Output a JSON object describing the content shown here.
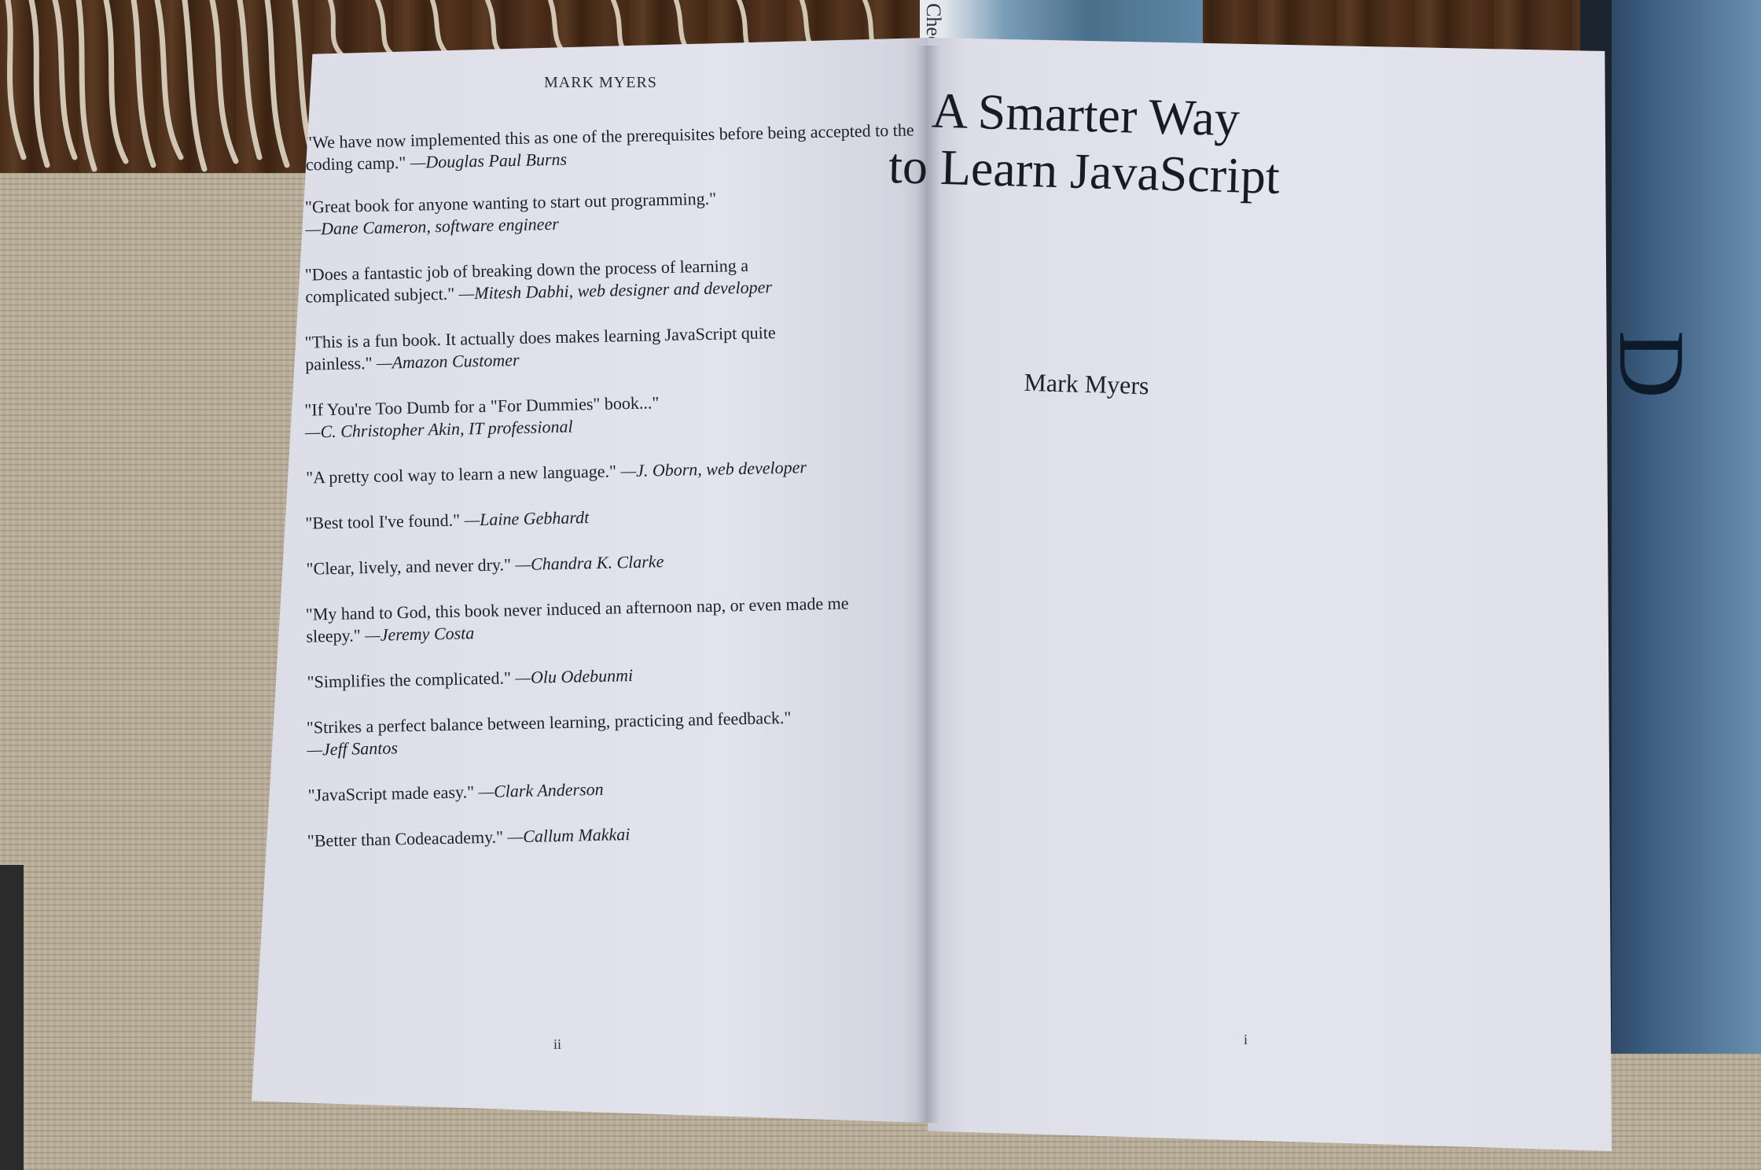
{
  "top_book": {
    "spine_text": "Chec"
  },
  "side_book": {
    "cover_letter": "D"
  },
  "left_page": {
    "running_head": "MARK MYERS",
    "page_number": "ii",
    "quotes": [
      {
        "text": "\"We have now implemented this as one of the prerequisites before being accepted to the coding camp.\" ",
        "attribution": "—Douglas Paul Burns"
      },
      {
        "text": "\"Great book for anyone wanting to start out programming.\" ",
        "attribution": "—Dane Cameron, software engineer"
      },
      {
        "text": "\"Does a fantastic job of breaking down the process of learning a complicated subject.\" ",
        "attribution": "—Mitesh Dabhi, web designer and developer"
      },
      {
        "text": "\"This is a fun book. It actually does makes learning JavaScript quite painless.\" ",
        "attribution": "—Amazon Customer"
      },
      {
        "text": "\"If You're Too Dumb for a \"For Dummies\" book...\" ",
        "attribution": "—C. Christopher Akin, IT professional"
      },
      {
        "text": "\"A pretty cool way to learn a new language.\" ",
        "attribution": "—J. Oborn, web developer"
      },
      {
        "text": "\"Best tool I've found.\" ",
        "attribution": "—Laine Gebhardt"
      },
      {
        "text": "\"Clear, lively, and never dry.\" ",
        "attribution": "—Chandra K. Clarke"
      },
      {
        "text": "\"My hand to God, this book never induced an afternoon nap, or even made me sleepy.\" ",
        "attribution": "—Jeremy Costa"
      },
      {
        "text": "\"Simplifies the complicated.\" ",
        "attribution": "—Olu Odebunmi"
      },
      {
        "text": "\"Strikes a perfect balance between learning, practicing and feedback.\" ",
        "attribution": "—Jeff Santos"
      },
      {
        "text": "\"JavaScript made easy.\" ",
        "attribution": "—Clark Anderson"
      },
      {
        "text": "\"Better than Codeacademy.\" ",
        "attribution": "—Callum Makkai"
      }
    ]
  },
  "right_page": {
    "title_line1": "A Smarter Way",
    "title_line2": "to Learn JavaScript",
    "author": "Mark Myers",
    "page_number": "i"
  }
}
